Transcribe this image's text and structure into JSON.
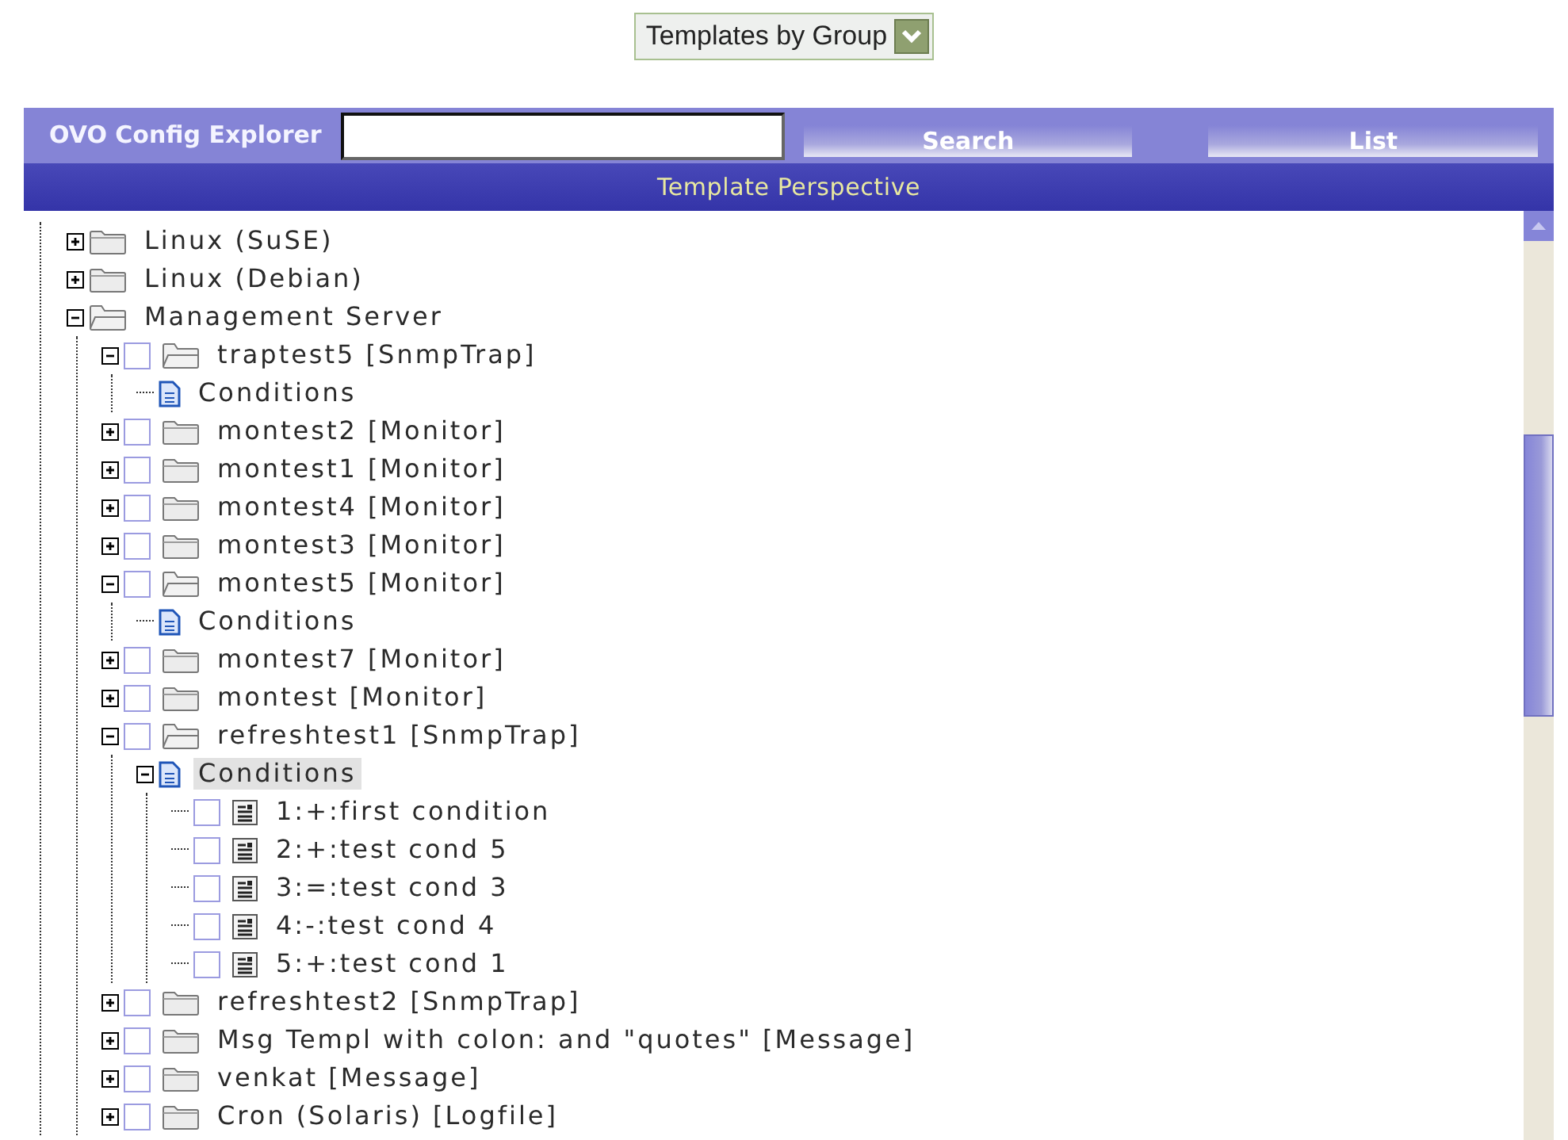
{
  "group_select": {
    "value": "Templates by Group"
  },
  "explorer": {
    "title": "OVO Config Explorer",
    "buttons": [
      "Search",
      "List"
    ],
    "perspective": "Template Perspective"
  },
  "tree": [
    {
      "label": "Linux (SuSE)",
      "kind": "folder",
      "expanded": false
    },
    {
      "label": "Linux (Debian)",
      "kind": "folder",
      "expanded": false
    },
    {
      "label": "Management Server",
      "kind": "folder",
      "expanded": true,
      "children": [
        {
          "label": "traptest5 [SnmpTrap]",
          "kind": "folder",
          "expanded": true,
          "checked": false,
          "children": [
            {
              "label": "Conditions",
              "kind": "document",
              "selected": false
            }
          ]
        },
        {
          "label": "montest2 [Monitor]",
          "kind": "folder",
          "expanded": false,
          "checked": false
        },
        {
          "label": "montest1 [Monitor]",
          "kind": "folder",
          "expanded": false,
          "checked": false
        },
        {
          "label": "montest4 [Monitor]",
          "kind": "folder",
          "expanded": false,
          "checked": false
        },
        {
          "label": "montest3 [Monitor]",
          "kind": "folder",
          "expanded": false,
          "checked": false
        },
        {
          "label": "montest5 [Monitor]",
          "kind": "folder",
          "expanded": true,
          "checked": false,
          "children": [
            {
              "label": "Conditions",
              "kind": "document",
              "selected": false
            }
          ]
        },
        {
          "label": "montest7 [Monitor]",
          "kind": "folder",
          "expanded": false,
          "checked": false
        },
        {
          "label": "montest [Monitor]",
          "kind": "folder",
          "expanded": false,
          "checked": false
        },
        {
          "label": "refreshtest1 [SnmpTrap]",
          "kind": "folder",
          "expanded": true,
          "checked": false,
          "children": [
            {
              "label": "Conditions",
              "kind": "document",
              "expanded": true,
              "selected": true,
              "children": [
                {
                  "label": "1:+:first condition",
                  "kind": "condition",
                  "checked": false
                },
                {
                  "label": "2:+:test cond 5",
                  "kind": "condition",
                  "checked": false
                },
                {
                  "label": "3:=:test cond 3",
                  "kind": "condition",
                  "checked": false
                },
                {
                  "label": "4:-:test cond 4",
                  "kind": "condition",
                  "checked": false
                },
                {
                  "label": "5:+:test cond 1",
                  "kind": "condition",
                  "checked": false
                }
              ]
            }
          ]
        },
        {
          "label": "refreshtest2 [SnmpTrap]",
          "kind": "folder",
          "expanded": false,
          "checked": false
        },
        {
          "label": "Msg Templ with colon: and \"quotes\" [Message]",
          "kind": "folder",
          "expanded": false,
          "checked": false
        },
        {
          "label": "venkat [Message]",
          "kind": "folder",
          "expanded": false,
          "checked": false
        },
        {
          "label": "Cron (Solaris) [Logfile]",
          "kind": "folder",
          "expanded": false,
          "checked": false
        }
      ]
    }
  ]
}
